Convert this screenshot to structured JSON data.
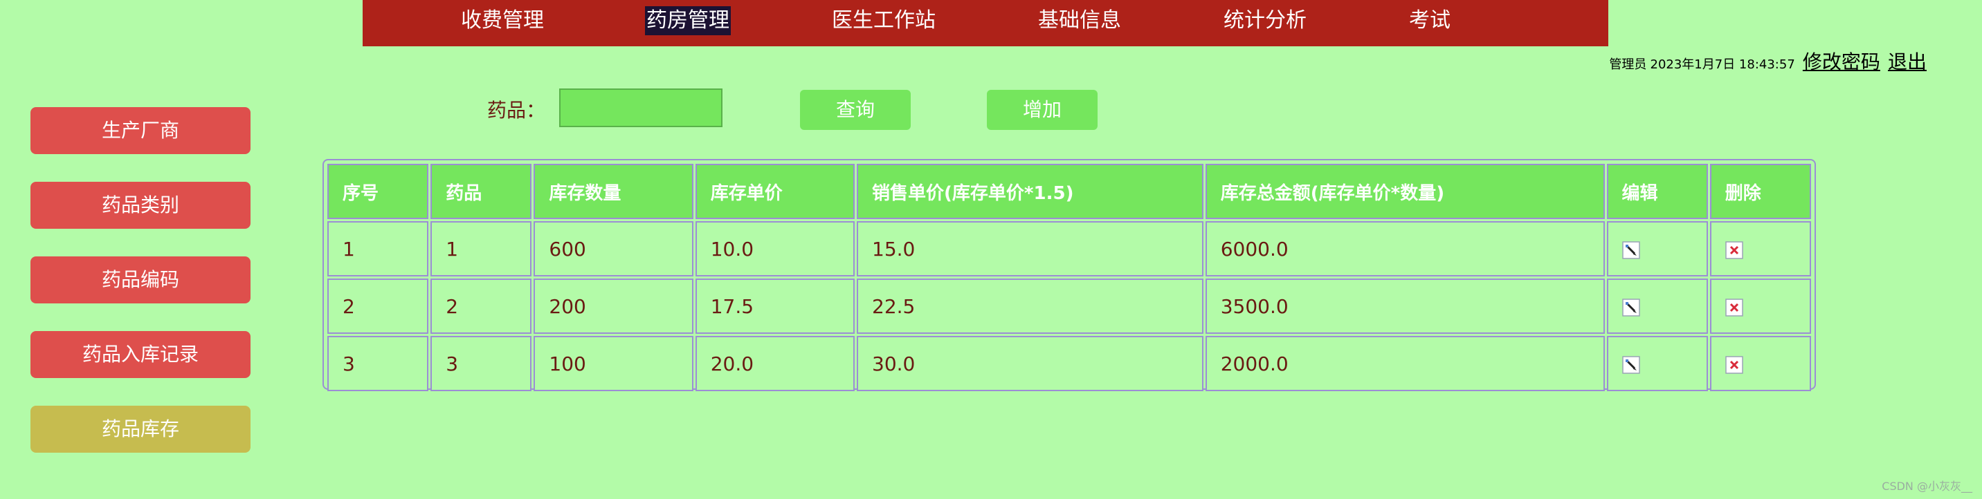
{
  "top_nav": {
    "items": [
      {
        "label": "收费管理"
      },
      {
        "label": "药房管理"
      },
      {
        "label": "医生工作站"
      },
      {
        "label": "基础信息"
      },
      {
        "label": "统计分析"
      },
      {
        "label": "考试"
      }
    ]
  },
  "user_info": {
    "role": "管理员",
    "datetime": "2023年1月7日 18:43:57",
    "change_password": "修改密码",
    "logout": "退出"
  },
  "sidebar": {
    "items": [
      {
        "label": "生产厂商"
      },
      {
        "label": "药品类别"
      },
      {
        "label": "药品编码"
      },
      {
        "label": "药品入库记录"
      },
      {
        "label": "药品库存"
      }
    ]
  },
  "search": {
    "label": "药品：",
    "value": "",
    "query_button": "查询",
    "add_button": "增加"
  },
  "table": {
    "headers": [
      "序号",
      "药品",
      "库存数量",
      "库存单价",
      "销售单价(库存单价*1.5)",
      "库存总金额(库存单价*数量)",
      "编辑",
      "删除"
    ],
    "rows": [
      [
        "1",
        "1",
        "600",
        "10.0",
        "15.0",
        "6000.0"
      ],
      [
        "2",
        "2",
        "200",
        "17.5",
        "22.5",
        "3500.0"
      ],
      [
        "3",
        "3",
        "100",
        "20.0",
        "30.0",
        "2000.0"
      ]
    ]
  },
  "watermark": "CSDN @小灰灰__",
  "colors": {
    "background": "#b3fba8",
    "nav_bar": "#ae2219",
    "nav_active": "#1c1233",
    "sidebar_button": "#de4f4c",
    "sidebar_active": "#c6bc4f",
    "green_accent": "#75e65d",
    "text": "#6a1a12",
    "table_border": "#9b8ed4"
  },
  "icons": {
    "edit": "pencil-edit-icon",
    "delete": "red-x-delete-icon"
  }
}
